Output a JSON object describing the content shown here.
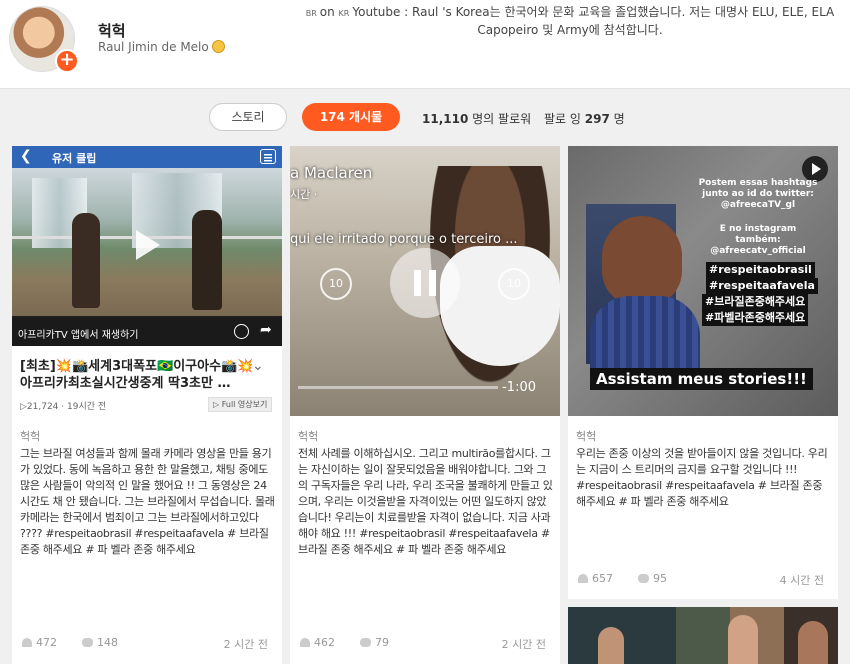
{
  "profile": {
    "name": "헉헉",
    "subname": "Raul Jimin de Melo",
    "bio_flag_br": "BR",
    "bio_flag_kr": "KR",
    "bio_on": "on",
    "bio_text": "Youtube : Raul 's Korea는 한국어와 문화 교육을 졸업했습니다. 저는 대명사 ELU, ELE, ELA Capopeiro 및 Army에 참석합니다."
  },
  "tabs": {
    "story": "스토리",
    "posts": "174 개시물",
    "followers_num": "11,110",
    "followers_label": "명의 팔로워",
    "following_label": "팔로 잉",
    "following_num": "297",
    "following_unit": "명"
  },
  "posts": [
    {
      "media_topbar": "유저 클립",
      "media_bottom": "아프리카TV 앱에서 재생하기",
      "title": "[최초]💥📸세계3대폭포🇧🇷이구아수📸💥아프리카최초실시간생중계 딱3초만 …",
      "views": "21,724",
      "ago": "19시간 전",
      "full_label": "Full 영상보기",
      "author": "헉헉",
      "caption": "그는 브라질 여성들과 함께 몰래 카메라 영상을 만들 용기가 있었다. 동에 녹음하고 용한 한 말을했고, 채팅 중에도 많은 사람들이 악의적 인 말을 했어요 !! 그 동영상은 24 시간도 채 안 됐습니다. 그는 브라질에서 무섭습니다. 몰래 카메라는 한국에서 범죄이고 그는 브라질에서하고있다 ???? #respeitaobrasil #respeitaafavela # 브라질 존중 해주세요 # 파 벨라 존중 해주세요",
      "likes": "472",
      "comments": "148",
      "time": "2 시간 전"
    },
    {
      "media_text1": "a Maclaren",
      "media_text2": "시간 ·",
      "media_text3": "qui ele irritado porque o terceiro ...",
      "skip_back": "10",
      "skip_fwd": "10",
      "remaining": "-1:00",
      "author": "헉헉",
      "caption": "전체 사례를 이해하십시오. 그리고 multirão를합시다. 그는 자신이하는 일이 잘못되었음을 배워야합니다. 그와 그의 구독자들은 우리 나라, 우리 조국을 불쾌하게 만들고 있으며, 우리는 이것을받을 자격이있는 어떤 일도하지 않았습니다! 우리는이 치료를받을 자격이 없습니다. 지금 사과해야 해요 !!! #respeitaobrasil #respeitaafavela # 브라질 존중 해주세요 # 파 벨라 존중 해주세요",
      "likes": "462",
      "comments": "79",
      "time": "2 시간 전"
    },
    {
      "overlay_top": "Postem essas hashtags junto ao id do twitter: @afreecaTV_gl",
      "overlay_mid": "E no instagram também: @afreecatv_official",
      "hashtags": [
        "#respeitaobrasil",
        "#respeitaafavela",
        "#브라질존중해주세요",
        "#파벨라존중해주세요"
      ],
      "banner": "Assistam meus stories!!!",
      "author": "헉헉",
      "caption": "우리는 존중 이상의 것을 받아들이지 않을 것입니다. 우리는 지금이 스 트리머의 금지를 요구할 것입니다 !!! #respeitaobrasil #respeitaafavela # 브라질 존중 해주세요 # 파 벨라 존중 해주세요",
      "likes": "657",
      "comments": "95",
      "time": "4 시간 전"
    }
  ],
  "colors": {
    "accent": "#ff5a1f",
    "page_bg": "#f0f0f0",
    "clip_bar": "#2f66b8"
  }
}
